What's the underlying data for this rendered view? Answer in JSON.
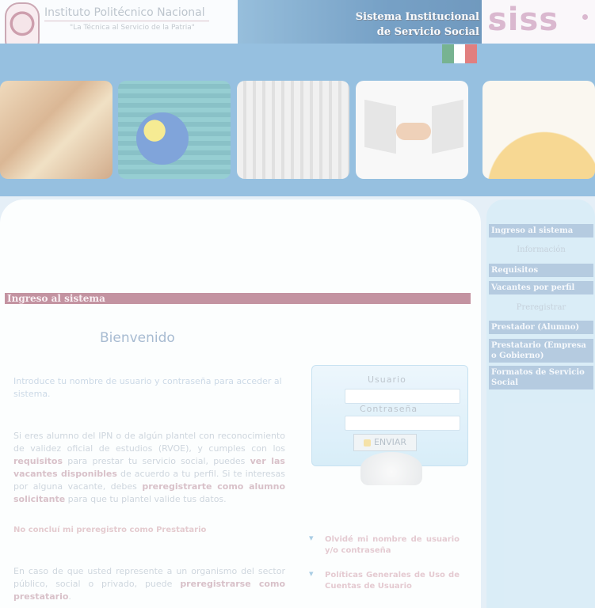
{
  "header": {
    "institution_name": "Instituto Politécnico Nacional",
    "institution_motto": "\"La Técnica al Servicio de la Patria\"",
    "system_title_line1": "Sistema Institucional",
    "system_title_line2": "de Servicio Social",
    "logo_text": "siss",
    "flag_colors": [
      "#2e8b57",
      "#ffffff",
      "#d23b3b"
    ]
  },
  "main": {
    "section_title": "Ingreso al sistema",
    "welcome": "Bienvenido",
    "intro": "Introduce tu nombre de usuario y contraseña para acceder al sistema.",
    "student_text": {
      "part1": "Si eres alumno del IPN o de algún plantel con reconocimiento de validez oficial de estudios (RVOE), y cumples con los ",
      "link_requirements": "requisitos",
      "part2": " para prestar tu servicio social, puedes ",
      "link_vacancies": "ver las vacantes disponibles",
      "part3": " de acuerdo a tu perfil. Si te interesas por alguna vacante, debes ",
      "link_preregister": "preregistrarte como alumno solicitante",
      "part4": " para que tu plantel valide tus datos."
    },
    "lender_link": "No concluí mi preregistro como Prestatario",
    "org_text": {
      "part1": "En caso de que usted represente a un organismo del sector público, social o privado, puede ",
      "link_preregister": "preregistrarse como prestatario",
      "part2": "."
    }
  },
  "login": {
    "user_label": "Usuario",
    "password_label": "Contraseña",
    "send_label": "ENVIAR"
  },
  "side_links": [
    {
      "label": "Olvidé mi nombre de usuario y/o contraseña"
    },
    {
      "label": "Políticas Generales de Uso de Cuentas de Usuario"
    }
  ],
  "menu": {
    "login": "Ingreso al sistema",
    "info_header": "Información",
    "requirements": "Requisitos",
    "vacancies": "Vacantes por perfil",
    "prereg_header": "Preregistrar",
    "provider": "Prestador (Alumno)",
    "lender": "Prestatario (Empresa o Gobierno)",
    "formats": "Formatos de Servicio Social"
  },
  "colors": {
    "header_blue": "#2e6fa8",
    "band_blue": "#5f9fd0",
    "section_bar": "#a4596f",
    "menu_item": "#8eafcf"
  }
}
